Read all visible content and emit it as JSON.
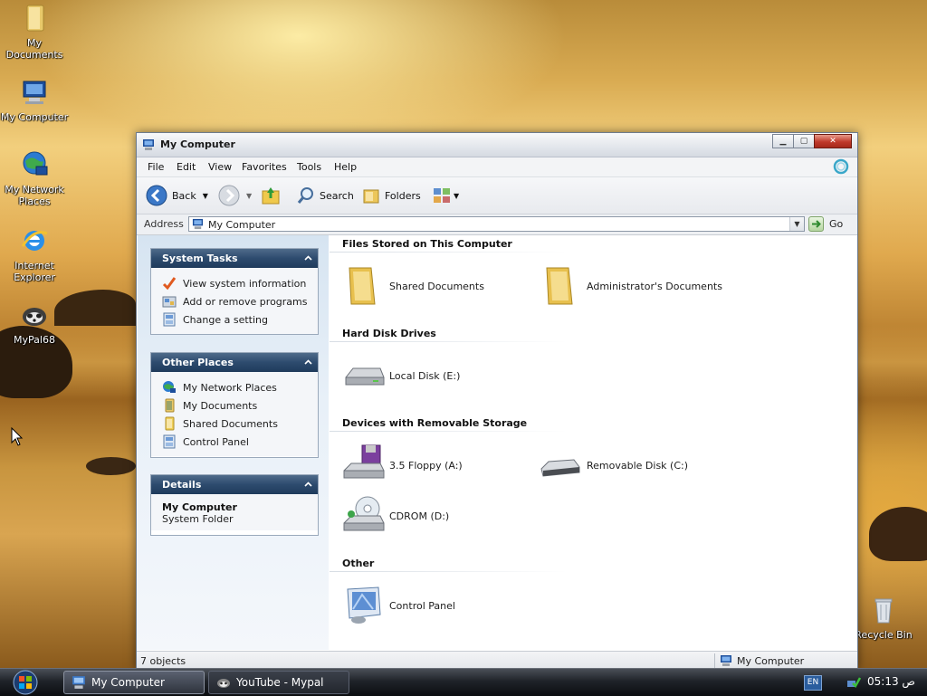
{
  "desktop": {
    "icons": [
      {
        "label": "My Documents"
      },
      {
        "label": "My Computer"
      },
      {
        "label": "My Network Places"
      },
      {
        "label": "Internet Explorer"
      },
      {
        "label": "MyPal68"
      },
      {
        "label": "Recycle Bin"
      }
    ]
  },
  "window": {
    "title": "My Computer",
    "menu": [
      "File",
      "Edit",
      "View",
      "Favorites",
      "Tools",
      "Help"
    ],
    "toolbar": {
      "back": "Back",
      "search": "Search",
      "folders": "Folders"
    },
    "address": {
      "label": "Address",
      "value": "My Computer",
      "go": "Go"
    },
    "taskpane": {
      "system_tasks": {
        "title": "System Tasks",
        "items": [
          "View system information",
          "Add or remove programs",
          "Change a setting"
        ]
      },
      "other_places": {
        "title": "Other Places",
        "items": [
          "My Network Places",
          "My Documents",
          "Shared Documents",
          "Control Panel"
        ]
      },
      "details": {
        "title": "Details",
        "name": "My Computer",
        "type": "System Folder"
      }
    },
    "groups": {
      "files": {
        "title": "Files Stored on This Computer",
        "items": [
          "Shared Documents",
          "Administrator's Documents"
        ]
      },
      "hdd": {
        "title": "Hard Disk Drives",
        "items": [
          "Local Disk (E:)"
        ]
      },
      "removable": {
        "title": "Devices with Removable Storage",
        "items": [
          "3.5 Floppy (A:)",
          "Removable Disk (C:)",
          "CDROM (D:)"
        ]
      },
      "other": {
        "title": "Other",
        "items": [
          "Control Panel"
        ]
      }
    },
    "status": {
      "count": "7 objects",
      "location": "My Computer"
    }
  },
  "taskbar": {
    "tasks": [
      "My Computer",
      "YouTube - Mypal"
    ],
    "language": "EN",
    "clock": "05:13 ص"
  },
  "colors": {
    "panel_header": "#2d4b6e",
    "taskbar": "#1f2329",
    "close_button": "#c0392b"
  }
}
